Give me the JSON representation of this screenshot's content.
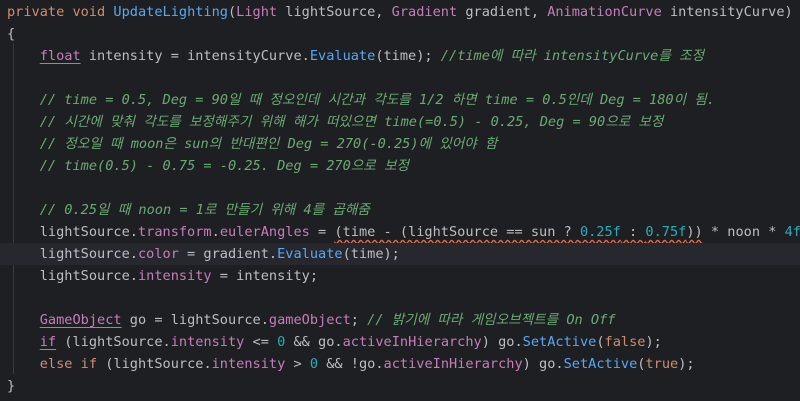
{
  "editor": {
    "background": "#1e1f22",
    "current_line_background": "#26282e",
    "lines": [
      {
        "hl": false,
        "tokens": [
          {
            "t": "private void ",
            "c": "kw"
          },
          {
            "t": "UpdateLighting",
            "c": "fn"
          },
          {
            "t": "(",
            "c": "pl"
          },
          {
            "t": "Light",
            "c": "ty"
          },
          {
            "t": " lightSource, ",
            "c": "pl"
          },
          {
            "t": "Gradient",
            "c": "ty"
          },
          {
            "t": " gradient, ",
            "c": "pl"
          },
          {
            "t": "AnimationCurve",
            "c": "ty"
          },
          {
            "t": " intensityCurve)",
            "c": "pl"
          }
        ]
      },
      {
        "hl": false,
        "tokens": [
          {
            "t": "{",
            "c": "pl"
          }
        ]
      },
      {
        "hl": false,
        "tokens": [
          {
            "t": "    ",
            "c": "pl"
          },
          {
            "t": "float",
            "c": "tyu"
          },
          {
            "t": " intensity = intensityCurve.",
            "c": "pl"
          },
          {
            "t": "Evaluate",
            "c": "fn"
          },
          {
            "t": "(time); ",
            "c": "pl"
          },
          {
            "t": "//time에 따라 intensityCurve를 조정",
            "c": "cmt"
          }
        ]
      },
      {
        "hl": false,
        "tokens": []
      },
      {
        "hl": false,
        "tokens": [
          {
            "t": "    ",
            "c": "pl"
          },
          {
            "t": "// time = 0.5, Deg = 90일 때 정오인데 시간과 각도를 1/2 하면 time = 0.5인데 Deg = 180이 됨.",
            "c": "cmt"
          }
        ]
      },
      {
        "hl": false,
        "tokens": [
          {
            "t": "    ",
            "c": "pl"
          },
          {
            "t": "// 시간에 맞춰 각도를 보정해주기 위해 해가 떠있으면 time(=0.5) - 0.25, Deg = 90으로 보정",
            "c": "cmt"
          }
        ]
      },
      {
        "hl": false,
        "tokens": [
          {
            "t": "    ",
            "c": "pl"
          },
          {
            "t": "// 정오일 때 moon은 sun의 반대편인 Deg = 270(-0.25)에 있어야 함",
            "c": "cmt"
          }
        ]
      },
      {
        "hl": false,
        "tokens": [
          {
            "t": "    ",
            "c": "pl"
          },
          {
            "t": "// time(0.5) - 0.75 = -0.25. Deg = 270으로 보정",
            "c": "cmt"
          }
        ]
      },
      {
        "hl": false,
        "tokens": []
      },
      {
        "hl": false,
        "tokens": [
          {
            "t": "    ",
            "c": "pl"
          },
          {
            "t": "// 0.25일 때 noon = 1로 만들기 위해 4를 곱해줌",
            "c": "cmt"
          }
        ]
      },
      {
        "hl": false,
        "tokens": [
          {
            "t": "    lightSource.",
            "c": "pl"
          },
          {
            "t": "transform",
            "c": "prop"
          },
          {
            "t": ".",
            "c": "pl"
          },
          {
            "t": "eulerAngles",
            "c": "prop"
          },
          {
            "t": " = ",
            "c": "pl"
          },
          {
            "t": "(time - (lightSource == sun ? ",
            "c": "pl",
            "w": true
          },
          {
            "t": "0.25f",
            "c": "num",
            "w": true
          },
          {
            "t": " : ",
            "c": "pl",
            "w": true
          },
          {
            "t": "0.75f",
            "c": "num",
            "w": true
          },
          {
            "t": "))",
            "c": "pl",
            "w": true
          },
          {
            "t": " * noon * ",
            "c": "pl"
          },
          {
            "t": "4f",
            "c": "num"
          },
          {
            "t": ";",
            "c": "pl"
          }
        ]
      },
      {
        "hl": true,
        "tokens": [
          {
            "t": "    lightSource.",
            "c": "pl"
          },
          {
            "t": "color",
            "c": "prop"
          },
          {
            "t": " = gradient.",
            "c": "pl"
          },
          {
            "t": "Evaluate",
            "c": "fn"
          },
          {
            "t": "(time);",
            "c": "pl"
          }
        ]
      },
      {
        "hl": false,
        "tokens": [
          {
            "t": "    lightSource.",
            "c": "pl"
          },
          {
            "t": "intensity",
            "c": "prop"
          },
          {
            "t": " = intensity;",
            "c": "pl"
          }
        ]
      },
      {
        "hl": false,
        "tokens": []
      },
      {
        "hl": false,
        "tokens": [
          {
            "t": "    ",
            "c": "pl"
          },
          {
            "t": "GameObject",
            "c": "tyu"
          },
          {
            "t": " go = lightSource.",
            "c": "pl"
          },
          {
            "t": "gameObject",
            "c": "prop"
          },
          {
            "t": "; ",
            "c": "pl"
          },
          {
            "t": "// 밝기에 따라 게임오브젝트를 On Off",
            "c": "cmt"
          }
        ]
      },
      {
        "hl": false,
        "tokens": [
          {
            "t": "    ",
            "c": "pl"
          },
          {
            "t": "if",
            "c": "tyu"
          },
          {
            "t": " (lightSource.",
            "c": "pl"
          },
          {
            "t": "intensity",
            "c": "prop"
          },
          {
            "t": " <= ",
            "c": "pl"
          },
          {
            "t": "0",
            "c": "num"
          },
          {
            "t": " && go.",
            "c": "pl"
          },
          {
            "t": "activeInHierarchy",
            "c": "prop"
          },
          {
            "t": ") go.",
            "c": "pl"
          },
          {
            "t": "SetActive",
            "c": "fn"
          },
          {
            "t": "(",
            "c": "pl"
          },
          {
            "t": "false",
            "c": "kw"
          },
          {
            "t": ");",
            "c": "pl"
          }
        ]
      },
      {
        "hl": false,
        "tokens": [
          {
            "t": "    ",
            "c": "pl"
          },
          {
            "t": "else if",
            "c": "kw"
          },
          {
            "t": " (lightSource.",
            "c": "pl"
          },
          {
            "t": "intensity",
            "c": "prop"
          },
          {
            "t": " > ",
            "c": "pl"
          },
          {
            "t": "0",
            "c": "num"
          },
          {
            "t": " && !go.",
            "c": "pl"
          },
          {
            "t": "activeInHierarchy",
            "c": "prop"
          },
          {
            "t": ") go.",
            "c": "pl"
          },
          {
            "t": "SetActive",
            "c": "fn"
          },
          {
            "t": "(",
            "c": "pl"
          },
          {
            "t": "true",
            "c": "kw"
          },
          {
            "t": ");",
            "c": "pl"
          }
        ]
      },
      {
        "hl": false,
        "tokens": [
          {
            "t": "}",
            "c": "pl"
          }
        ]
      }
    ]
  }
}
